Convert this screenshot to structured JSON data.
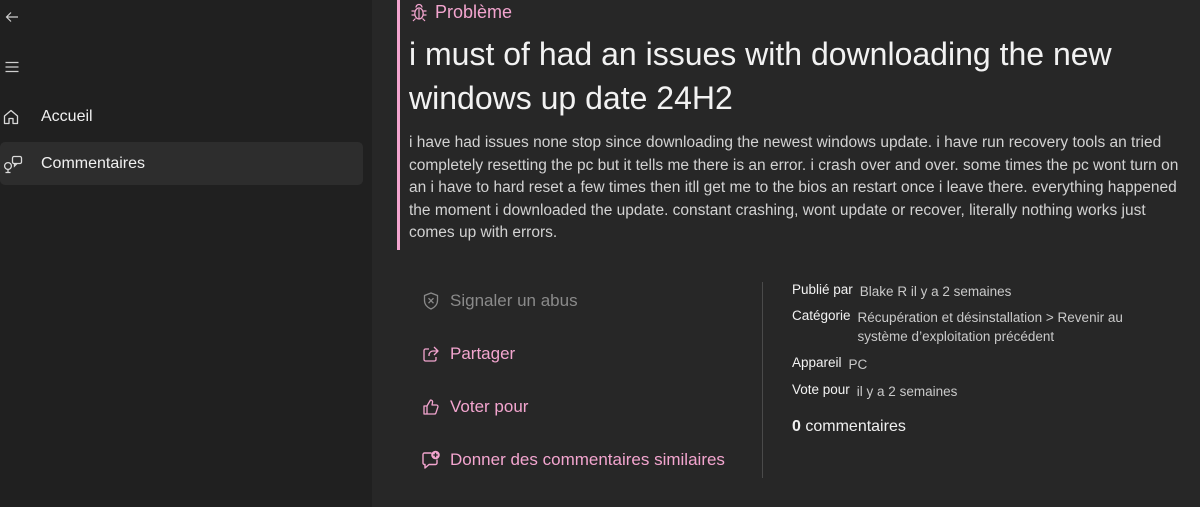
{
  "sidebar": {
    "back_icon": "arrow-left-icon",
    "menu_icon": "hamburger-icon",
    "items": [
      {
        "label": "Accueil",
        "icon": "home-icon"
      },
      {
        "label": "Commentaires",
        "icon": "feedback-icon"
      }
    ]
  },
  "feedback": {
    "type_label": "Problème",
    "type_icon": "bug-icon",
    "title": "i must of had an issues with downloading the new windows up date 24H2",
    "description": "i have had issues none stop since downloading the newest windows update. i have run recovery tools an tried completely resetting the pc but it tells me there is an error. i crash over and over. some times the pc wont turn on an i have to hard reset  a few times then itll get me to the bios an restart once i leave there. everything happened the moment i downloaded the update. constant crashing, wont update or recover, literally nothing works just comes up with errors."
  },
  "actions": {
    "report": "Signaler un abus",
    "share": "Partager",
    "vote": "Voter pour",
    "similar": "Donner des commentaires similaires"
  },
  "meta": {
    "published_key": "Publié par",
    "published_val": "Blake R il y a 2 semaines",
    "category_key": "Catégorie",
    "category_val_line1": "Récupération et désinstallation > Revenir au",
    "category_val_line2": "système d’exploitation précédent",
    "device_key": "Appareil",
    "device_val": "PC",
    "vote_key": "Vote pour",
    "vote_val": "il y a 2 semaines",
    "comments_count": "0",
    "comments_label": "commentaires"
  },
  "colors": {
    "accent": "#f3a5cf",
    "background": "#202020",
    "content_background": "#272727"
  }
}
